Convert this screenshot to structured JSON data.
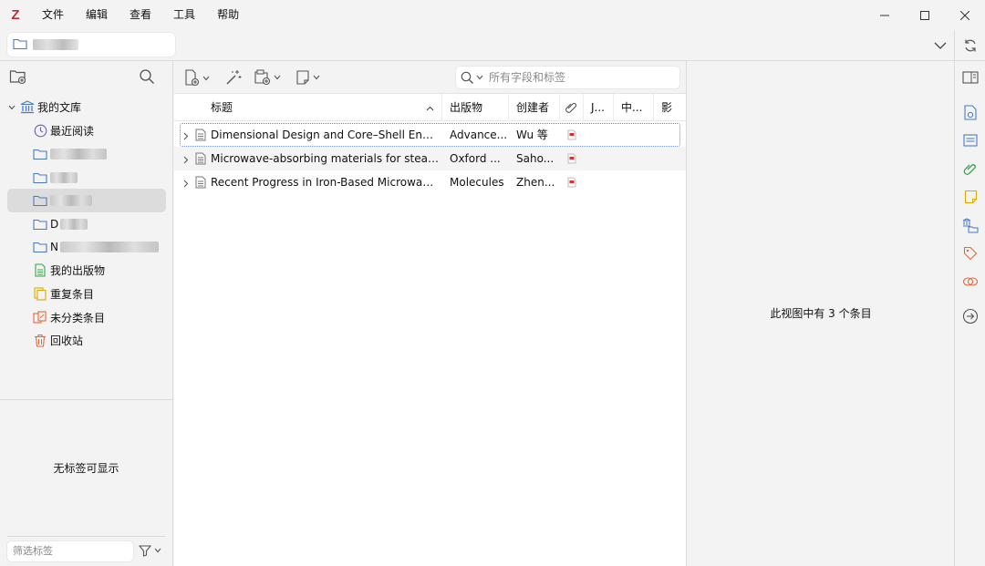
{
  "app": {
    "logo": "Z"
  },
  "menu": [
    "文件",
    "编辑",
    "查看",
    "工具",
    "帮助"
  ],
  "collections": {
    "library": "我的文库",
    "recent": "最近阅读",
    "d_prefix": "D",
    "n_prefix": "N",
    "my_publications": "我的出版物",
    "duplicates": "重复条目",
    "unfiled": "未分类条目",
    "trash": "回收站"
  },
  "tags": {
    "empty_message": "无标签可显示",
    "filter_placeholder": "筛选标签"
  },
  "search": {
    "placeholder": "所有字段和标签"
  },
  "columns": {
    "title": "标题",
    "publication": "出版物",
    "creator": "创建者",
    "j": "J...",
    "zh": "中...",
    "impact": "影"
  },
  "items": [
    {
      "title": "Dimensional Design and Core–Shell Engi...",
      "publication": "Advance...",
      "creator": "Wu 等"
    },
    {
      "title": "Microwave-absorbing materials for stealt...",
      "publication": "Oxford ...",
      "creator": "Saho..."
    },
    {
      "title": "Recent Progress in Iron-Based Microwave...",
      "publication": "Molecules",
      "creator": "Zhen..."
    }
  ],
  "item_pane": {
    "message": "此视图中有 3 个条目"
  },
  "colors": {
    "logo_red": "#cc2936",
    "accent_blue": "#4a78c8",
    "pdf_red": "#d7342f"
  }
}
